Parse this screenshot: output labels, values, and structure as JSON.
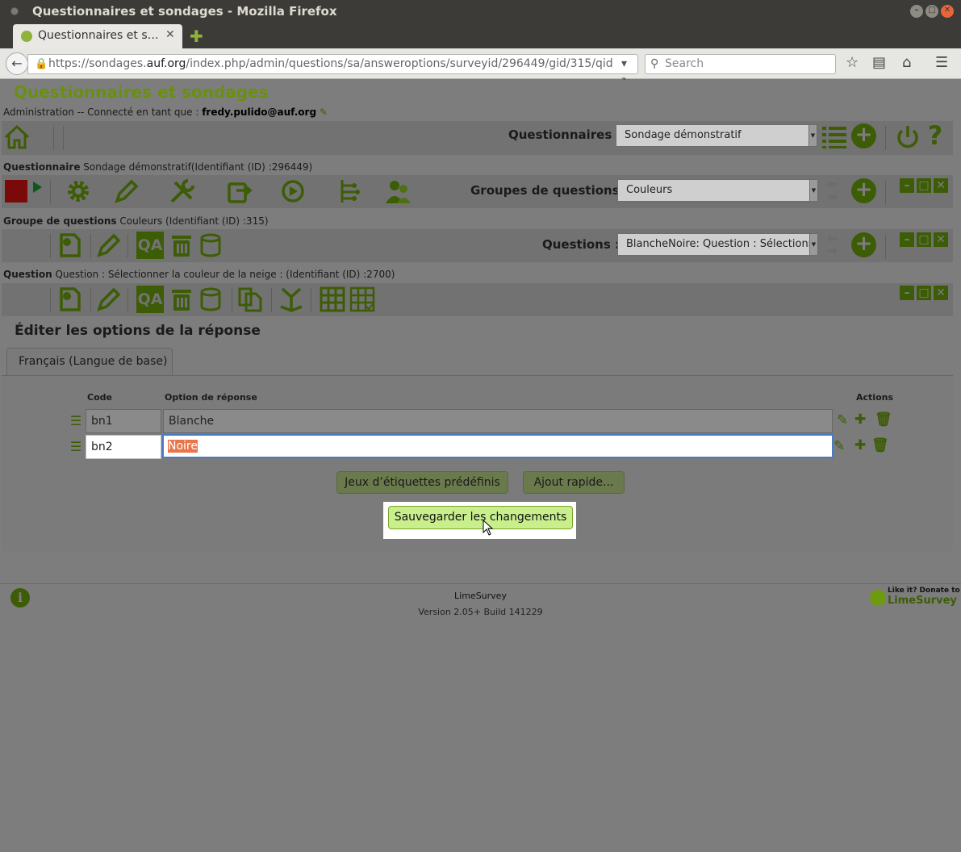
{
  "window": {
    "title": "Questionnaires et sondages - Mozilla Firefox",
    "tab_label": "Questionnaires et s…",
    "tab_close": "✕",
    "new_tab": "✚"
  },
  "browser": {
    "url_prefix": "https://sondages.",
    "url_domain": "auf.org",
    "url_rest": "/index.php/admin/questions/sa/answeroptions/surveyid/296449/gid/315/qid/",
    "search_placeholder": "Search"
  },
  "app": {
    "title": "Questionnaires et sondages",
    "admin_prefix": "Administration",
    "admin_connected": " -- Connecté en tant que : ",
    "admin_user": "fredy.pulido@auf.org"
  },
  "survey_bar": {
    "label": "Questionnaires :",
    "selected": "Sondage démonstratif"
  },
  "survey_section": {
    "label_bold": "Questionnaire",
    "label_text": " Sondage démonstratif(Identifiant (ID) :296449)"
  },
  "group_bar": {
    "label": "Groupes de questions :",
    "selected": "Couleurs"
  },
  "group_section": {
    "label_bold": "Groupe de questions",
    "label_text": "  Couleurs (Identifiant (ID) :315)"
  },
  "question_bar": {
    "label": "Questions :",
    "selected": "BlancheNoire: Question : Sélectionne"
  },
  "question_section": {
    "label_bold": "Question",
    "label_text": " Question : Sélectionner la couleur de la neige : (Identifiant (ID) :2700)"
  },
  "editor": {
    "heading": "Éditer les options de la réponse",
    "language_tab": "Français (Langue de base)",
    "columns": {
      "code": "Code",
      "option": "Option de réponse",
      "actions": "Actions"
    },
    "rows": [
      {
        "code": "bn1",
        "option": "Blanche"
      },
      {
        "code": "bn2",
        "option": "Noire"
      }
    ],
    "predefined_button": "Jeux d’étiquettes prédéfinis",
    "quick_add_button": "Ajout rapide...",
    "save_button": "Sauvegarder les changements"
  },
  "footer": {
    "name": "LimeSurvey",
    "version": "Version 2.05+ Build 141229",
    "donate_line1": "Like it? Donate to",
    "donate_line2": "LimeSurvey"
  },
  "colors": {
    "brand_green": "#6a8f10",
    "icon_green_dimmed": "#3d5c06",
    "overlay_gray": "#7d7d7d",
    "save_button": "#c8ef8c",
    "text_selection": "#e9764a"
  }
}
